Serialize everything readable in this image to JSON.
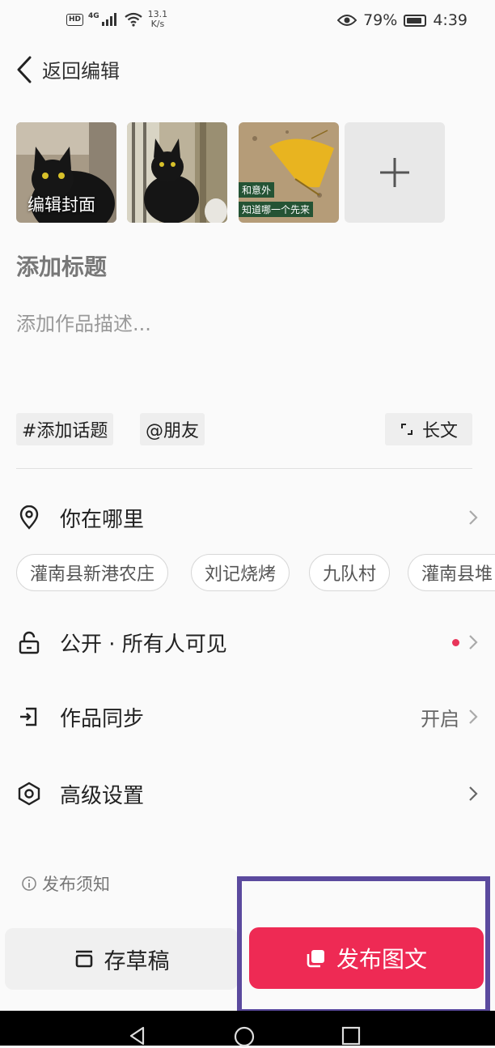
{
  "status_bar": {
    "hd": "HD",
    "network": "4G",
    "speed_value": "13.1",
    "speed_unit": "K/s",
    "battery": "79%",
    "time": "4:39"
  },
  "header": {
    "back_label": "返回编辑"
  },
  "media": {
    "cover_label": "编辑封面",
    "leaf_caption_line1": "和意外",
    "leaf_caption_line2": "知道哪一个先来"
  },
  "editor": {
    "title_placeholder": "添加标题",
    "description_placeholder": "添加作品描述..."
  },
  "chips": {
    "topic": "#添加话题",
    "mention": "@朋友",
    "long_text": "长文"
  },
  "location": {
    "label": "你在哪里",
    "suggestions": [
      "灌南县新港农庄",
      "刘记烧烤",
      "九队村",
      "灌南县堆"
    ]
  },
  "visibility": {
    "label": "公开 · 所有人可见"
  },
  "sync": {
    "label": "作品同步",
    "value": "开启"
  },
  "advanced": {
    "label": "高级设置"
  },
  "notice": "发布须知",
  "actions": {
    "draft": "存草稿",
    "publish": "发布图文"
  },
  "colors": {
    "accent": "#ee2a54",
    "highlight_box": "#5b4a9e"
  }
}
